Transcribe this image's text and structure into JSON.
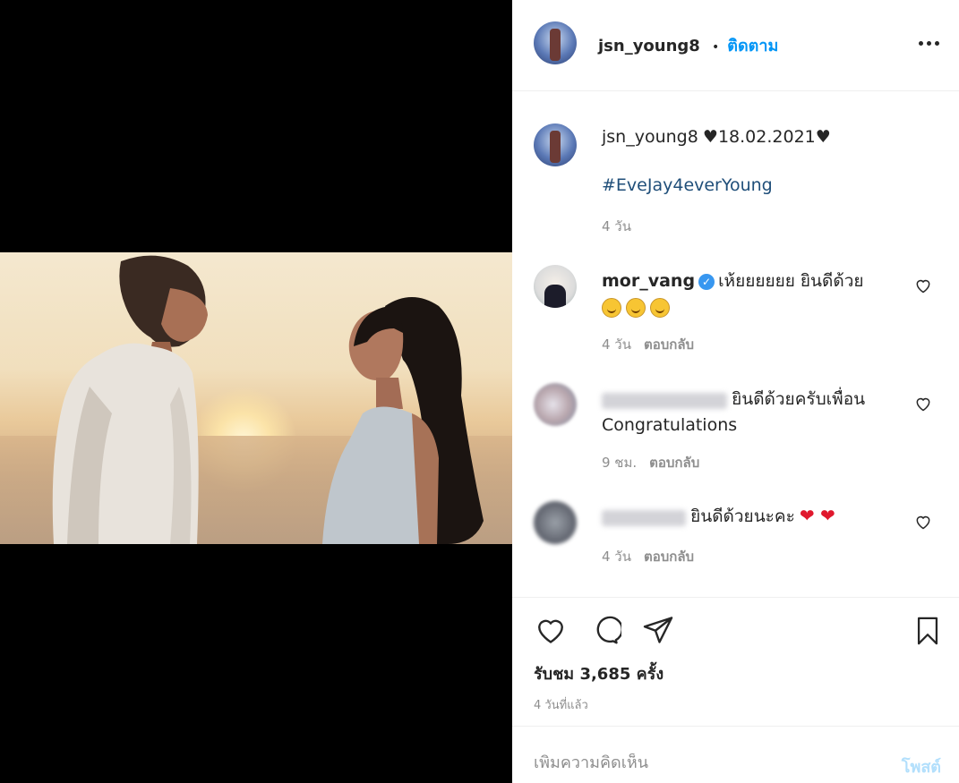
{
  "post": {
    "author": "jsn_young8",
    "follow_label": "ติดตาม",
    "dot": "•",
    "caption": {
      "username": "jsn_young8",
      "text": "♥18.02.2021♥",
      "hashtag": "#EveJay4everYoung",
      "time": "4 วัน"
    },
    "comments": [
      {
        "username": "mor_vang",
        "verified": true,
        "text": "เห้ยยยยยย ยินดีด้วย",
        "emoji": [
          "smile",
          "smile",
          "smile"
        ],
        "time": "4 วัน",
        "reply": "ตอบกลับ"
      },
      {
        "username_blurred": true,
        "text": "ยินดีด้วยครับเพื่อน",
        "text2": "Congratulations",
        "time": "9 ชม.",
        "reply": "ตอบกลับ"
      },
      {
        "username_blurred": true,
        "text": "ยินดีด้วยนะคะ",
        "hearts": "❤ ❤",
        "time": "4 วัน",
        "reply": "ตอบกลับ"
      }
    ],
    "views": "รับชม 3,685 ครั้ง",
    "posted_ago": "4 วันที่แล้ว",
    "comment_placeholder": "เพิ่มความคิดเห็น",
    "post_button": "โพสต์"
  },
  "colors": {
    "link": "#0095f6",
    "hashtag": "#1f4e79",
    "muted": "#8e8e8e",
    "heart": "#e0182d"
  }
}
